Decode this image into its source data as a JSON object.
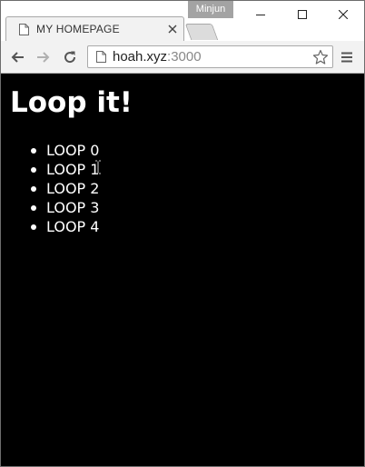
{
  "browser": {
    "profile_name": "Minjun",
    "tab": {
      "title": "MY HOMEPAGE"
    },
    "address_bar": {
      "host": "hoah.xyz",
      "port": ":3000"
    }
  },
  "page": {
    "heading": "Loop it!",
    "items": [
      "LOOP 0",
      "LOOP 1",
      "LOOP 2",
      "LOOP 3",
      "LOOP 4"
    ]
  },
  "colors": {
    "page_background": "#000000",
    "page_text": "#ffffff",
    "profile_badge": "#a3a3a3"
  }
}
